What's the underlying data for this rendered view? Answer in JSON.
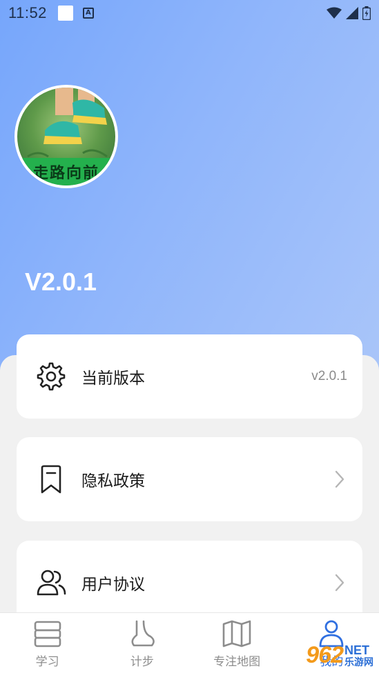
{
  "status_bar": {
    "time": "11:52",
    "notification_letter": "A",
    "icons": [
      "wifi-icon",
      "signal-icon",
      "battery-icon"
    ]
  },
  "profile": {
    "avatar_caption": "走路向前",
    "version_label": "V2.0.1"
  },
  "menu": {
    "items": [
      {
        "icon": "gear-icon",
        "label": "当前版本",
        "value": "v2.0.1"
      },
      {
        "icon": "bookmark-icon",
        "label": "隐私政策"
      },
      {
        "icon": "users-icon",
        "label": "用户协议"
      }
    ]
  },
  "tabbar": {
    "tabs": [
      {
        "icon": "book-stack-icon",
        "label": "学习"
      },
      {
        "icon": "foot-icon",
        "label": "计步"
      },
      {
        "icon": "map-icon",
        "label": "专注地图"
      },
      {
        "icon": "person-icon",
        "label": "我的"
      }
    ]
  },
  "watermark": {
    "number": "962",
    "suffix": "NET",
    "site": "乐游网"
  },
  "colors": {
    "hero_gradient_start": "#76a6fb",
    "hero_gradient_end": "#a9c5f9",
    "active_tab": "#2f6fe0",
    "inactive_tab": "#8d8d8d"
  }
}
